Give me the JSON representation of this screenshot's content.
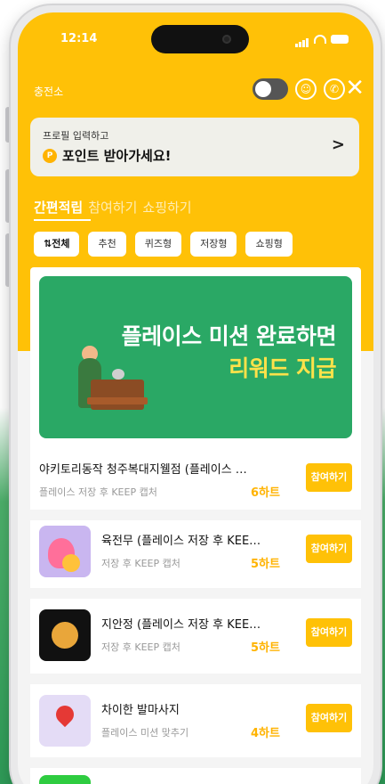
{
  "status": {
    "time": "12:14"
  },
  "header": {
    "label": "충전소"
  },
  "promo": {
    "small": "프로필 입력하고",
    "big": "포인트 받아가세요!",
    "coin": "P",
    "chevron": ">"
  },
  "tabs": [
    {
      "label": "간편적립",
      "active": true
    },
    {
      "label": "참여하기",
      "active": false
    },
    {
      "label": "쇼핑하기",
      "active": false
    }
  ],
  "chips": [
    {
      "label": "⇅전체",
      "active": true
    },
    {
      "label": "추천"
    },
    {
      "label": "퀴즈형"
    },
    {
      "label": "저장형"
    },
    {
      "label": "쇼핑형"
    }
  ],
  "banner": {
    "line1": "플레이스 미션 완료하면",
    "line2": "리워드 지급"
  },
  "items": [
    {
      "title": "야키토리동작 청주복대지웰점 (플레이스 …",
      "sub": "플레이스 저장 후 KEEP 캡처",
      "reward": "6하트",
      "button": "참여하기"
    },
    {
      "title": "육전무 (플레이스 저장 후 KEE…",
      "sub": "저장 후 KEEP 캡처",
      "reward": "5하트",
      "button": "참여하기",
      "thumb_color": "#c9b6f0"
    },
    {
      "title": "지안정 (플레이스 저장 후 KEE…",
      "sub": "저장 후 KEEP 캡처",
      "reward": "5하트",
      "button": "참여하기",
      "thumb_color": "#111111"
    },
    {
      "title": "차이한 발마사지",
      "sub": "플레이스 미션 맞추기",
      "reward": "4하트",
      "button": "참여하기",
      "thumb_color": "#e4dcf6"
    }
  ],
  "colors": {
    "accent": "#ffc107",
    "reward": "#ffb300",
    "banner": "#2aa865"
  }
}
